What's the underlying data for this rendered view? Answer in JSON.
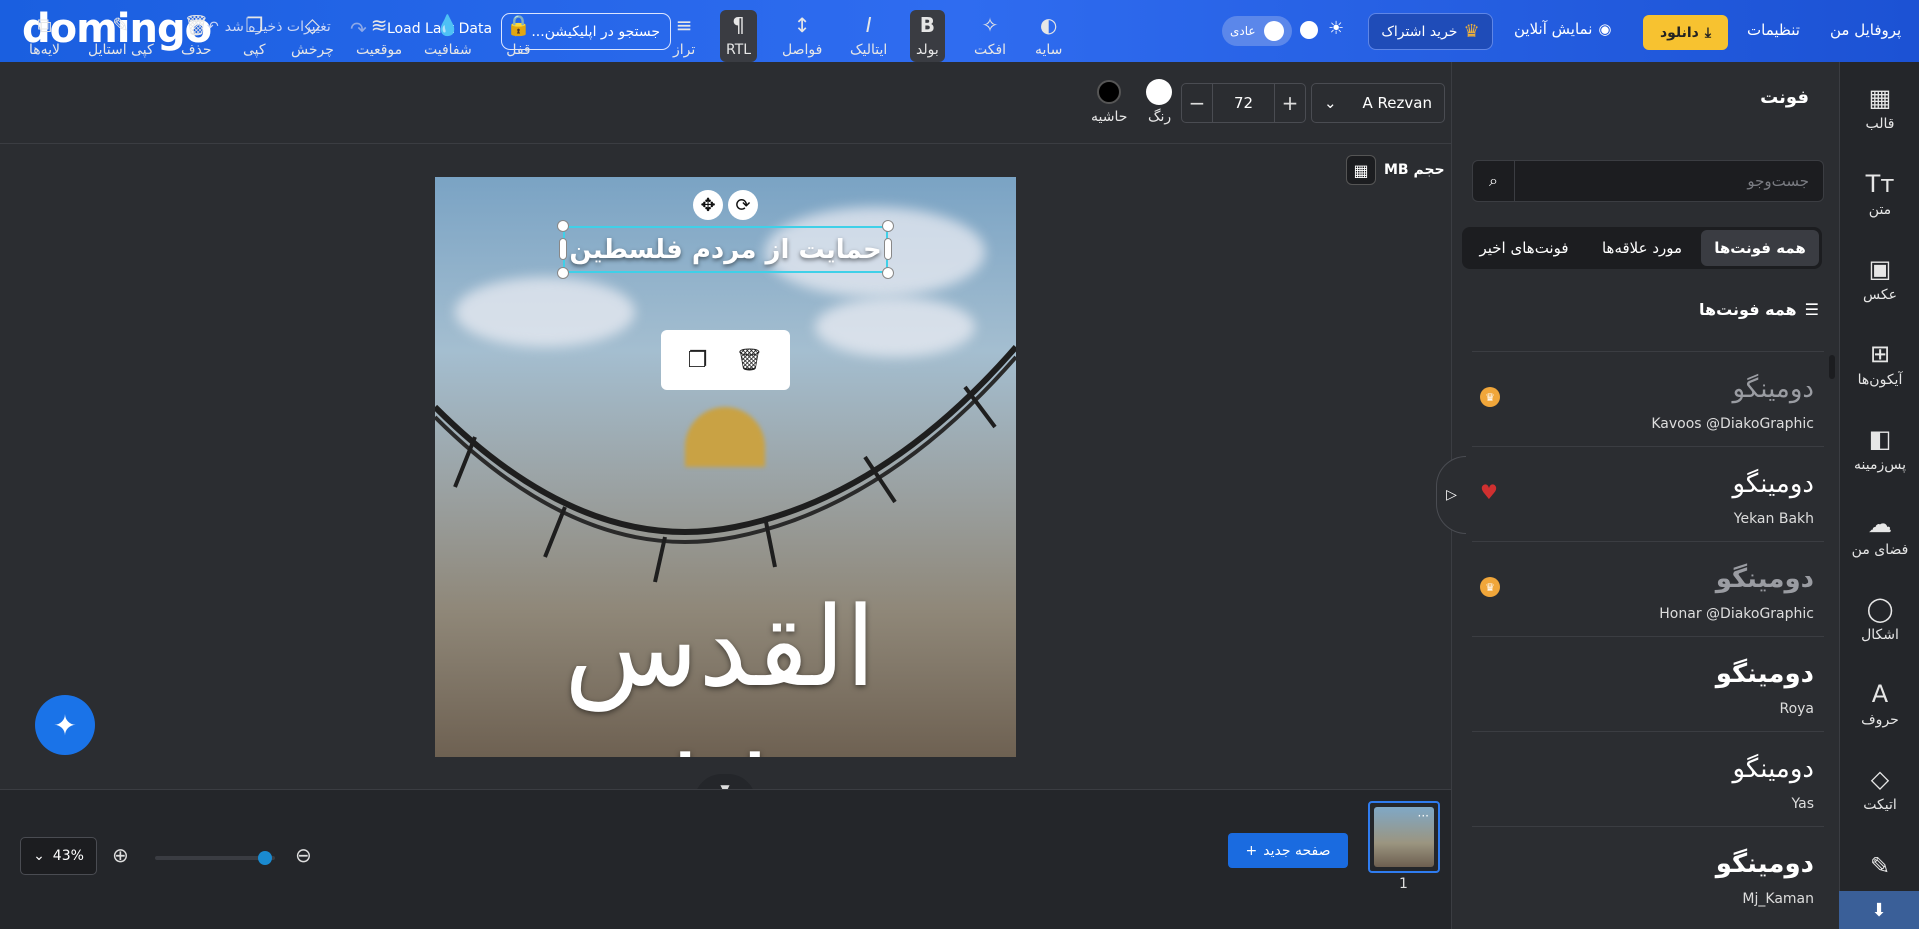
{
  "header": {
    "logo": "domingo",
    "save_status": "تغییرات ذخیره شد",
    "load_last": "Load Last Data",
    "search_placeholder": "جستجو در اپلیکیشن...",
    "mode_label": "عادی",
    "subscribe": "خرید اشتراک",
    "online_view": "نمایش آنلاین",
    "download": "دانلود",
    "settings": "تنظیمات",
    "profile": "پروفایل من"
  },
  "toolbar": {
    "layers": "لایه‌ها",
    "copy_style": "کپی استایل",
    "delete": "حذف",
    "copy": "کپی",
    "rotate": "چرخش",
    "position": "موقعیت",
    "opacity": "شفافیت",
    "lock": "قفل",
    "align": "تراز",
    "rtl": "RTL",
    "spacing": "فواصل",
    "italic": "ایتالیک",
    "bold": "بولد",
    "effect": "افکت",
    "shadow": "سایه",
    "border": "حاشیه",
    "color": "رنگ",
    "font_size": "72",
    "font_name": "A Rezvan"
  },
  "canvas": {
    "size_label": "حجم MB",
    "headline": "حمایت از مردم فلسطین",
    "calligraphy": "القدس لنا"
  },
  "bottom": {
    "zoom": "43%",
    "new_page": "صفحه جدید",
    "page_number": "1"
  },
  "panel": {
    "title": "فونت",
    "search_placeholder": "جست‌وجو",
    "tabs": [
      "همه فونت‌ها",
      "مورد علاقه‌ها",
      "فونت‌های اخیر"
    ],
    "list_title": "همه فونت‌ها",
    "fonts": [
      {
        "sample": "دومینگو",
        "name": "Kavoos @DiakoGraphic",
        "badge": "premium"
      },
      {
        "sample": "دومینگو",
        "name": "Yekan Bakh",
        "badge": "favorite"
      },
      {
        "sample": "دومینگو",
        "name": "Honar @DiakoGraphic",
        "badge": "premium"
      },
      {
        "sample": "دومینگو",
        "name": "Roya",
        "badge": ""
      },
      {
        "sample": "دومینگو",
        "name": "Yas",
        "badge": ""
      },
      {
        "sample": "دومینگو",
        "name": "Mj_Kaman",
        "badge": ""
      }
    ]
  },
  "rail": {
    "items": [
      "قالب",
      "متن",
      "عکس",
      "آیکون‌ها",
      "پس‌زمینه",
      "فضای من",
      "اشکال",
      "حروف",
      "اتیکت"
    ]
  }
}
